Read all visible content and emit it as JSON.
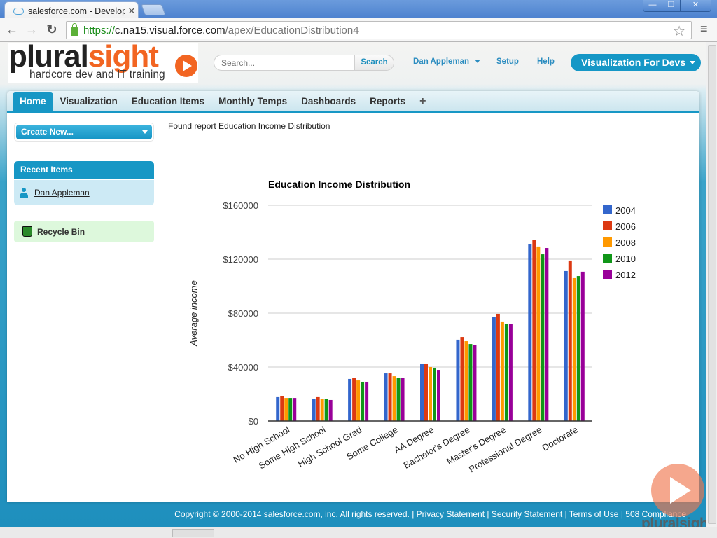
{
  "browser": {
    "tab_title": "salesforce.com - Develope",
    "url_scheme": "https://",
    "url_host": "c.na15.visual.force.com",
    "url_path": "/apex/EducationDistribution4",
    "window_buttons": {
      "minimize": "—",
      "restore": "❐",
      "close": "✕"
    }
  },
  "header": {
    "logo_word_a": "plural",
    "logo_word_b": "sight",
    "logo_tagline": "hardcore dev and IT training",
    "search_placeholder": "Search...",
    "search_button": "Search",
    "user_menu": "Dan Appleman",
    "setup": "Setup",
    "help": "Help",
    "app_menu": "Visualization For Devs"
  },
  "nav": {
    "tabs": [
      {
        "label": "Home",
        "active": true
      },
      {
        "label": "Visualization"
      },
      {
        "label": "Education Items"
      },
      {
        "label": "Monthly Temps"
      },
      {
        "label": "Dashboards"
      },
      {
        "label": "Reports"
      },
      {
        "label": "+"
      }
    ]
  },
  "sidebar": {
    "create_new": "Create New...",
    "recent_items_title": "Recent Items",
    "recent_items": [
      "Dan Appleman"
    ],
    "recycle_bin": "Recycle Bin"
  },
  "main": {
    "status": "Found report Education Income Distribution"
  },
  "chart_data": {
    "type": "bar",
    "title": "Education Income Distribution",
    "xlabel": "",
    "ylabel": "Average income",
    "ylim": [
      0,
      160000
    ],
    "yticks": [
      0,
      40000,
      80000,
      120000,
      160000
    ],
    "ytick_labels": [
      "$0",
      "$40000",
      "$80000",
      "$120000",
      "$160000"
    ],
    "grid": true,
    "legend_position": "right",
    "categories": [
      "No High School",
      "Some High School",
      "High School Grad",
      "Some College",
      "AA Degree",
      "Bachelor's Degree",
      "Master's Degree",
      "Professional Degree",
      "Doctorate"
    ],
    "series": [
      {
        "name": "2004",
        "color": "#3366cc",
        "values": [
          17700,
          16600,
          31200,
          35300,
          42600,
          60300,
          77400,
          130900,
          111200
        ]
      },
      {
        "name": "2006",
        "color": "#dc3912",
        "values": [
          18200,
          17700,
          31700,
          35300,
          42600,
          62300,
          79500,
          134500,
          119000
        ]
      },
      {
        "name": "2008",
        "color": "#ff9900",
        "values": [
          17100,
          16600,
          30100,
          33200,
          40000,
          59200,
          73800,
          129400,
          106000
        ]
      },
      {
        "name": "2010",
        "color": "#109618",
        "values": [
          17100,
          16600,
          29100,
          32200,
          39500,
          57100,
          72200,
          123600,
          107500
        ]
      },
      {
        "name": "2012",
        "color": "#990099",
        "values": [
          17100,
          15600,
          29100,
          31700,
          37900,
          56600,
          71700,
          128300,
          110700
        ]
      }
    ]
  },
  "footer": {
    "copyright": "Copyright © 2000-2014 salesforce.com, inc. All rights reserved.",
    "links": [
      "Privacy Statement",
      "Security Statement",
      "Terms of Use",
      "508 Compliance"
    ],
    "separator": " | "
  },
  "watermark": {
    "text": "pluralsight"
  }
}
